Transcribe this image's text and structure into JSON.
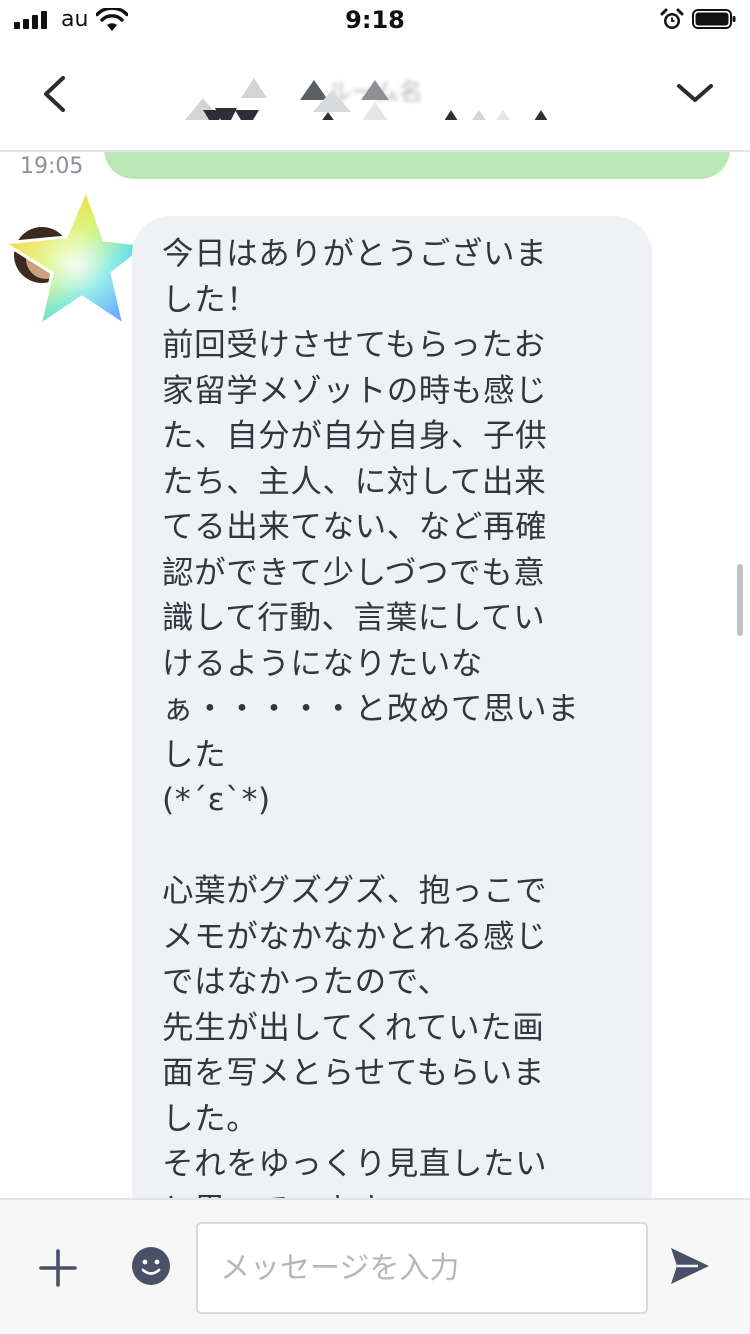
{
  "status_bar": {
    "carrier": "au",
    "time": "9:18",
    "icons": [
      "signal-icon",
      "wifi-icon",
      "alarm-icon",
      "battery-icon"
    ]
  },
  "header": {
    "title": "ルーム名",
    "icons": [
      "chevron-left-icon",
      "chevron-down-icon"
    ]
  },
  "chat": {
    "timestamp": "19:05",
    "received_message": "今日はありがとうございま\nした！\n前回受けさせてもらったお\n家留学メゾットの時も感じ\nた、自分が自分自身、子供\nたち、主人、に対して出来\nてる出来てない、など再確\n認ができて少しづつでも意\n識して行動、言葉にしてい\nけるようになりたいな\nぁ・・・・・と改めて思いました\n(*ˊεˋ*)\n\n心葉がグズグズ、抱っこで\nメモがなかなかとれる感じ\nではなかったので、\n先生が出してくれていた画\n面を写メとらせてもらいま\nした。\nそれをゆっくり見直したい\nと思っています。",
    "avatar_icon": "rainbow-star-avatar"
  },
  "input_bar": {
    "placeholder": "メッセージを入力",
    "icons": [
      "plus-icon",
      "emoji-icon",
      "send-icon"
    ]
  },
  "colors": {
    "sent_bubble": "#b9e8b5",
    "received_bubble": "#f0f1f4",
    "icon": "#4a5066"
  }
}
